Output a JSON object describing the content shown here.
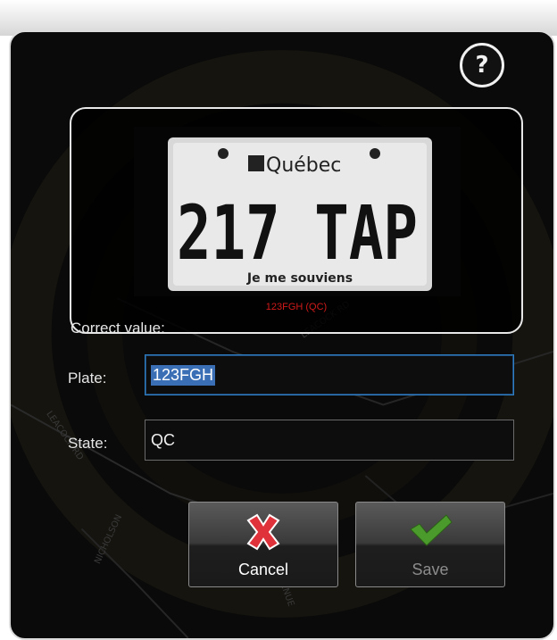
{
  "dialog": {
    "help_symbol": "?",
    "help_icon": "question-icon",
    "plate_caption": "123FGH (QC)",
    "plate_image": {
      "province": "Québec",
      "number": "217 TAP",
      "motto": "Je me souviens"
    },
    "map_street_labels": [
      "LEACOCK RD",
      "LEACOCK RD",
      "NICHOLSON",
      "AVENUE"
    ],
    "correct_value_label": "Correct value:",
    "plate_label": "Plate:",
    "plate_value": "123FGH",
    "state_label": "State:",
    "state_value": "QC",
    "cancel_label": "Cancel",
    "save_label": "Save",
    "cancel_icon": "x-icon",
    "save_icon": "checkmark-icon",
    "colors": {
      "caption": "#d21a1a",
      "focus_border": "#2f7fc4",
      "selection": "#3a6fb5",
      "cancel_icon": "#e0323a",
      "save_icon": "#4a9a2c"
    }
  }
}
